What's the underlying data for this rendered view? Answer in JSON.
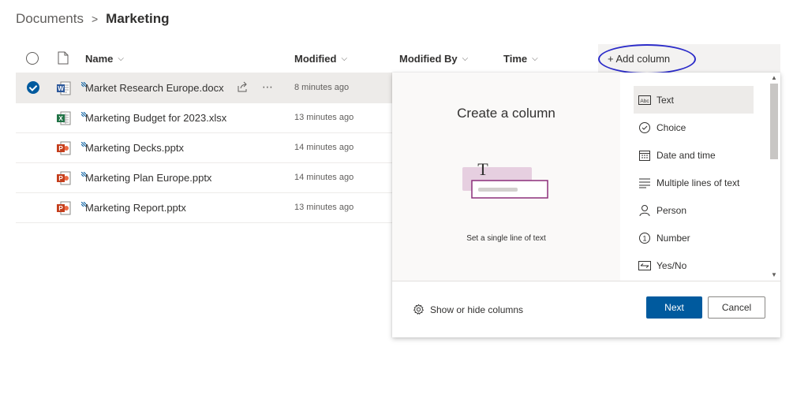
{
  "breadcrumb": {
    "root": "Documents",
    "separator": ">",
    "current": "Marketing"
  },
  "columns": {
    "name": "Name",
    "modified": "Modified",
    "modified_by": "Modified By",
    "time": "Time",
    "add_column": "+ Add column"
  },
  "files": [
    {
      "name": "Market Research Europe.docx",
      "modified": "8 minutes ago",
      "type": "word",
      "selected": true
    },
    {
      "name": "Marketing Budget for 2023.xlsx",
      "modified": "13 minutes ago",
      "type": "excel",
      "selected": false
    },
    {
      "name": "Marketing Decks.pptx",
      "modified": "14 minutes ago",
      "type": "powerpoint",
      "selected": false
    },
    {
      "name": "Marketing Plan Europe.pptx",
      "modified": "14 minutes ago",
      "type": "powerpoint",
      "selected": false
    },
    {
      "name": "Marketing Report.pptx",
      "modified": "13 minutes ago",
      "type": "powerpoint",
      "selected": false
    }
  ],
  "panel": {
    "title": "Create a column",
    "description": "Set a single line of text",
    "types": [
      {
        "label": "Text",
        "icon": "text-abc-icon"
      },
      {
        "label": "Choice",
        "icon": "circle-check-icon"
      },
      {
        "label": "Date and time",
        "icon": "calendar-icon"
      },
      {
        "label": "Multiple lines of text",
        "icon": "lines-icon"
      },
      {
        "label": "Person",
        "icon": "person-icon"
      },
      {
        "label": "Number",
        "icon": "number-circle-icon"
      },
      {
        "label": "Yes/No",
        "icon": "toggle-icon"
      }
    ],
    "selected_type": "Text",
    "show_hide": "Show or hide columns",
    "next": "Next",
    "cancel": "Cancel"
  },
  "colors": {
    "accent": "#005a9e",
    "selected_row": "#edebe9",
    "annotation": "#2c2cc9"
  }
}
